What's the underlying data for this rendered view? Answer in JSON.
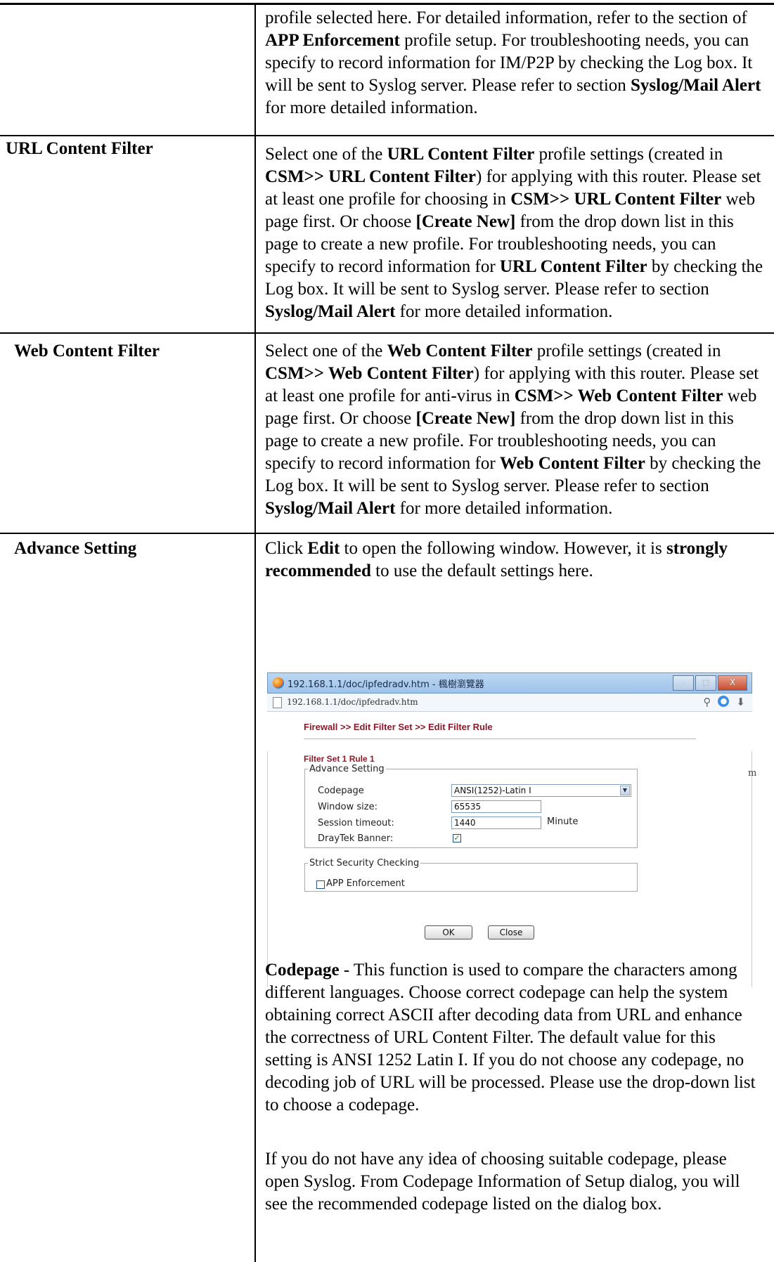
{
  "row0": {
    "continuation_text_html": "profile selected here. For detailed information, refer to the section of <b>APP Enforcement</b> profile setup. For troubleshooting needs, you can specify to record information for IM/P2P by checking the Log box. It will be sent to Syslog server. Please refer to section <b>Syslog/Mail Alert</b> for more detailed information."
  },
  "row1": {
    "label": "URL Content Filter",
    "text_html": "Select one of the <b>URL Content Filter</b> profile settings (created in <b>CSM&gt;&gt; URL Content Filter</b>) for applying with this router. Please set at least one profile for choosing in <b>CSM&gt;&gt; URL Content Filter</b> web page first. Or choose <b>[Create New]</b> from the drop down list in this page to create a new profile. For troubleshooting needs, you can specify to record information for <b>URL Content Filter</b> by checking the Log box. It will be sent to Syslog server. Please refer to section <b>Syslog/Mail Alert</b> for more detailed information."
  },
  "row2": {
    "label": "Web Content Filter",
    "text_html": "Select one of the <b>Web Content Filter</b> profile settings (created in <b>CSM&gt;&gt; Web Content Filter</b>) for applying with this router. Please set at least one profile for anti-virus in <b>CSM&gt;&gt; Web Content Filter</b> web page first. Or choose <b>[Create New]</b> from the drop down list in this page to create a new profile. For troubleshooting needs, you can specify to record information for <b>Web Content Filter</b> by checking the Log box. It will be sent to Syslog server. Please refer to section <b>Syslog/Mail Alert</b> for more detailed information."
  },
  "row3": {
    "label": "Advance Setting",
    "intro_html": "Click <b>Edit</b> to open the following window. However, it is <b>strongly recommended</b> to use the default settings here.",
    "codepage_html": "<b>Codepage</b> - This function is used to compare the characters among different languages. Choose correct codepage can help the system obtaining correct ASCII after decoding data from URL and enhance the correctness of URL Content Filter. The default value for this setting is ANSI 1252 Latin I. If you do not choose any codepage, no decoding job of URL will be processed. Please use the drop-down list to choose a codepage.",
    "syslog_html": "If you do not have any idea of choosing suitable codepage, please open Syslog. From Codepage Information of Setup dialog, you will see the recommended codepage listed on the dialog box."
  },
  "screenshot": {
    "window_title": "192.168.1.1/doc/ipfedradv.htm - 楓樹瀏覽器",
    "window_buttons": [
      "–",
      "□",
      "X"
    ],
    "url": "192.168.1.1/doc/ipfedradv.htm",
    "breadcrumb": "Firewall >> Edit Filter Set >> Edit Filter Rule",
    "filter_set_title": "Filter Set 1 Rule 1",
    "advance_legend": "Advance Setting",
    "codepage_label": "Codepage",
    "codepage_value": "ANSI(1252)-Latin I",
    "window_size_label": "Window size:",
    "window_size_value": "65535",
    "session_timeout_label": "Session timeout:",
    "session_timeout_value": "1440",
    "session_timeout_unit": "Minute",
    "draytek_banner_label": "DrayTek Banner:",
    "draytek_banner_checked": true,
    "strict_legend": "Strict Security Checking",
    "app_enforcement_label": "APP Enforcement",
    "app_enforcement_checked": false,
    "ok_label": "OK",
    "close_label": "Close",
    "side_fragment": "m"
  }
}
